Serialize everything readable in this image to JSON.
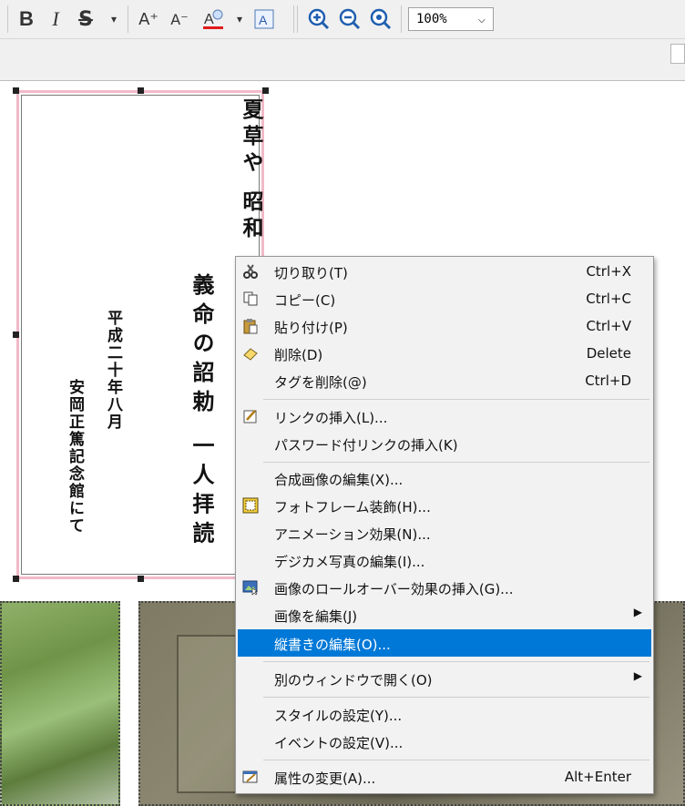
{
  "toolbar": {
    "bold": "B",
    "italic": "I",
    "strike": "S",
    "dropdown": "▾",
    "font_up": "A⁺",
    "font_down": "A⁻",
    "zoom_value": "100%",
    "zoom_arrow": "⌵",
    "icons": {
      "zoom_in": "zoom-in-icon",
      "zoom_out": "zoom-out-icon",
      "zoom_fit": "zoom-fit-icon"
    }
  },
  "poem": {
    "col1": "夏草や 昭和",
    "col2": "義命の詔勅 一人拝読",
    "col3": "平成二十年八月",
    "col4": "安岡正篤記念館にて"
  },
  "context_menu": {
    "items": [
      {
        "label": "切り取り(T)",
        "shortcut": "Ctrl+X",
        "icon": "scissors-icon"
      },
      {
        "label": "コピー(C)",
        "shortcut": "Ctrl+C",
        "icon": "copy-icon"
      },
      {
        "label": "貼り付け(P)",
        "shortcut": "Ctrl+V",
        "icon": "paste-icon"
      },
      {
        "label": "削除(D)",
        "shortcut": "Delete",
        "icon": "eraser-icon"
      },
      {
        "label": "タグを削除(@)",
        "shortcut": "Ctrl+D",
        "icon": ""
      },
      {
        "label": "リンクの挿入(L)...",
        "shortcut": "",
        "icon": "link-edit-icon"
      },
      {
        "label": "パスワード付リンクの挿入(K)",
        "shortcut": "",
        "icon": ""
      },
      {
        "label": "合成画像の編集(X)...",
        "shortcut": "",
        "icon": ""
      },
      {
        "label": "フォトフレーム装飾(H)...",
        "shortcut": "",
        "icon": "photo-frame-icon"
      },
      {
        "label": "アニメーション効果(N)...",
        "shortcut": "",
        "icon": ""
      },
      {
        "label": "デジカメ写真の編集(I)...",
        "shortcut": "",
        "icon": ""
      },
      {
        "label": "画像のロールオーバー効果の挿入(G)...",
        "shortcut": "",
        "icon": "rollover-image-icon"
      },
      {
        "label": "画像を編集(J)",
        "shortcut": "",
        "icon": "",
        "submenu": "▶"
      },
      {
        "label": "縦書きの編集(O)...",
        "shortcut": "",
        "icon": ""
      },
      {
        "label": "別のウィンドウで開く(O)",
        "shortcut": "",
        "icon": "",
        "submenu": "▶"
      },
      {
        "label": "スタイルの設定(Y)...",
        "shortcut": "",
        "icon": ""
      },
      {
        "label": "イベントの設定(V)...",
        "shortcut": "",
        "icon": ""
      },
      {
        "label": "属性の変更(A)...",
        "shortcut": "Alt+Enter",
        "icon": "properties-icon"
      }
    ],
    "highlight_color": "#0078d7"
  },
  "colors": {
    "frame_border": "#f2b9c9",
    "menu_bg": "#f2f2f2"
  }
}
